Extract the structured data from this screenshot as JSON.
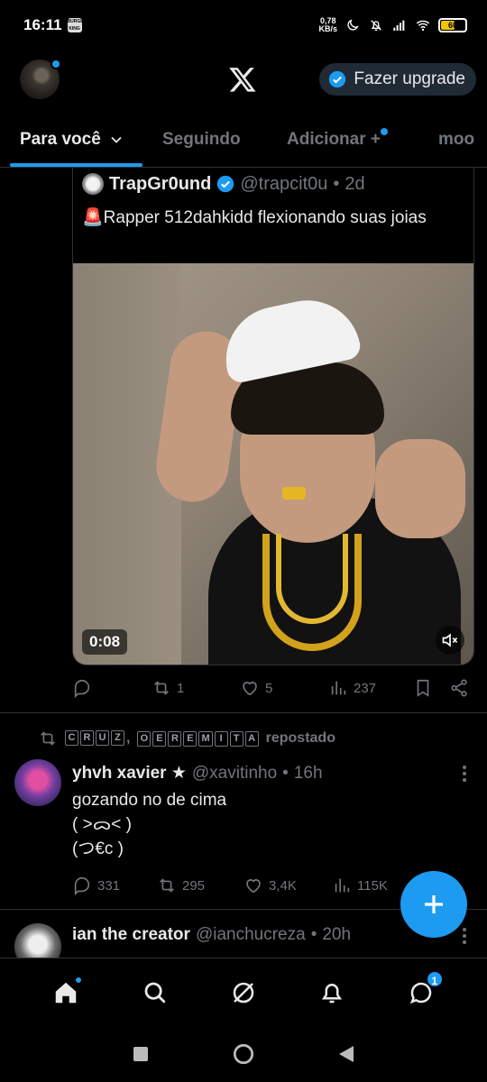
{
  "status_bar": {
    "time": "16:11",
    "speed_value": "0,78",
    "speed_unit": "KB/s",
    "battery": "60"
  },
  "header": {
    "upgrade_label": "Fazer upgrade",
    "brand_color": "#1d9bf0"
  },
  "tabs": [
    {
      "label": "Para você",
      "active": true
    },
    {
      "label": "Seguindo"
    },
    {
      "label": "Adicionar +"
    },
    {
      "label": "moo"
    }
  ],
  "quoted_post": {
    "name": "TrapGr0und",
    "handle": "@trapcit0u",
    "time": "2d",
    "text": "🚨Rapper 512dahkidd flexionando suas joias",
    "video_time": "0:08"
  },
  "post1_actions": {
    "replies": "",
    "reposts": "1",
    "likes": "5",
    "views": "237"
  },
  "repost_banner": {
    "boxed_letters": [
      "C",
      "R",
      "U",
      "Z",
      ",",
      "O",
      "E",
      "R",
      "E",
      "M",
      "I",
      "T",
      "A"
    ],
    "suffix": "repostado"
  },
  "post2": {
    "name": "yhvh xavier ★",
    "handle": "@xavitinho",
    "time": "16h",
    "text": "gozando no de cima\n( >ᯅ< )\n(つ€c )",
    "replies": "331",
    "reposts": "295",
    "likes": "3,4K",
    "views": "115K"
  },
  "post3": {
    "name": "ian the creator",
    "handle": "@ianchucreza",
    "time": "20h"
  },
  "bottom_nav": {
    "messages_badge": "1"
  }
}
